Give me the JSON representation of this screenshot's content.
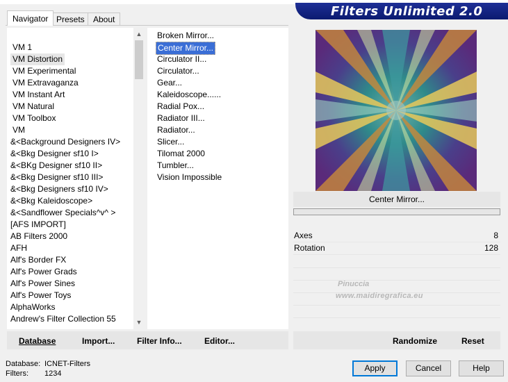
{
  "header": {
    "title": "Filters Unlimited 2.0"
  },
  "tabs": [
    {
      "label": "Navigator",
      "active": true
    },
    {
      "label": "Presets",
      "active": false
    },
    {
      "label": "About",
      "active": false
    }
  ],
  "categories": [
    "VM 1",
    "VM Distortion",
    "VM Experimental",
    "VM Extravaganza",
    "VM Instant Art",
    "VM Natural",
    "VM Toolbox",
    "VM",
    "&<Background Designers IV>",
    "&<Bkg Designer sf10 I>",
    "&<BKg Designer sf10 II>",
    "&<Bkg Designer sf10 III>",
    "&<Bkg Designers sf10 IV>",
    "&<Bkg Kaleidoscope>",
    "&<Sandflower Specials^v^ >",
    "[AFS IMPORT]",
    "AB Filters 2000",
    "AFH",
    "Alf's Border FX",
    "Alf's Power Grads",
    "Alf's Power Sines",
    "Alf's Power Toys",
    "AlphaWorks",
    "Andrew's Filter Collection 55"
  ],
  "selected_category": "VM Distortion",
  "filters": [
    "Broken Mirror...",
    "Center Mirror...",
    "Circulator II...",
    "Circulator...",
    "Gear...",
    "Kaleidoscope......",
    "Radial Pox...",
    "Radiator III...",
    "Radiator...",
    "Slicer...",
    "Tilomat 2000",
    "Tumbler...",
    "Vision Impossible"
  ],
  "selected_filter": "Center Mirror...",
  "preview": {
    "filter_name": "Center Mirror..."
  },
  "params": [
    {
      "label": "Axes",
      "value": "8"
    },
    {
      "label": "Rotation",
      "value": "128"
    }
  ],
  "watermark": {
    "name": "Pinuccia",
    "url": "www.maidiregrafica.eu"
  },
  "left_buttons": {
    "database": "Database",
    "import": "Import...",
    "filter_info": "Filter Info...",
    "editor": "Editor..."
  },
  "right_buttons": {
    "randomize": "Randomize",
    "reset": "Reset"
  },
  "status": {
    "database_label": "Database:",
    "database_value": "ICNET-Filters",
    "filters_label": "Filters:",
    "filters_value": "1234"
  },
  "dialog_buttons": {
    "apply": "Apply",
    "cancel": "Cancel",
    "help": "Help"
  },
  "colors": {
    "banner": "#1e2f96",
    "selection": "#3a6ed6",
    "default_border": "#0078d7"
  }
}
